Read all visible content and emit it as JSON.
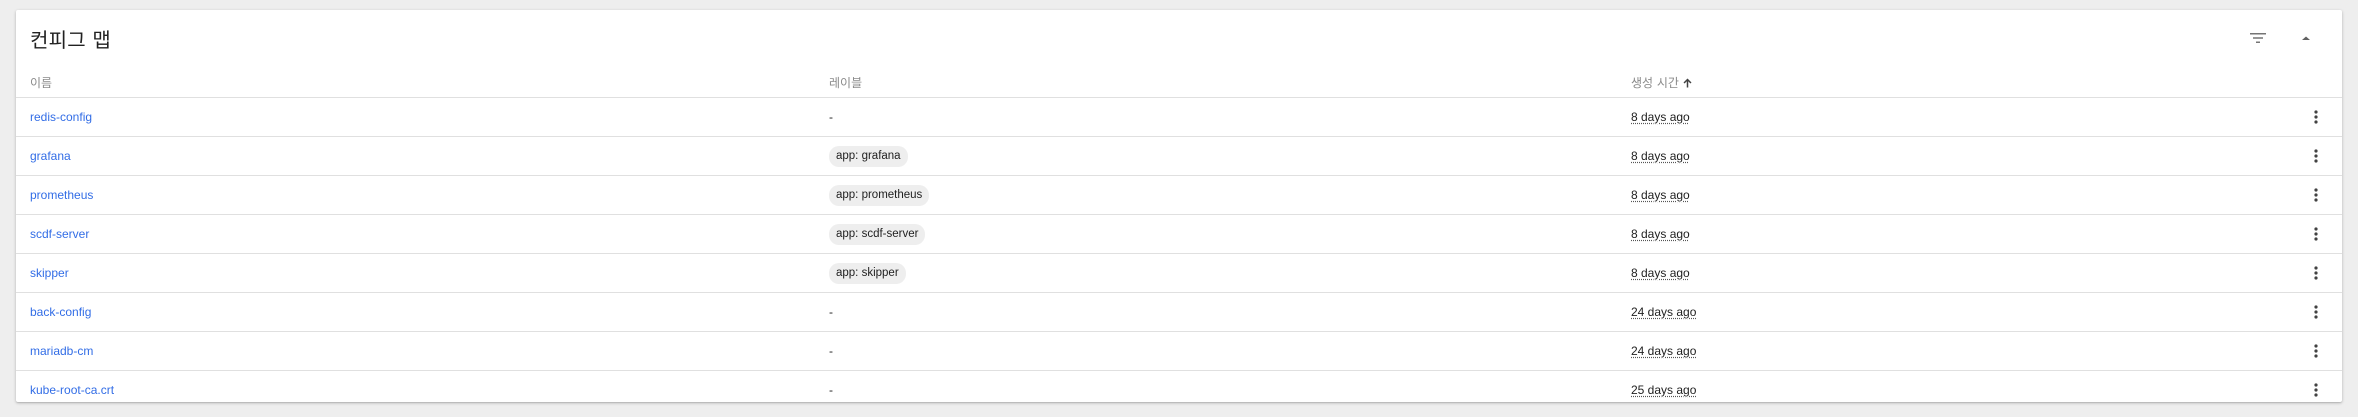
{
  "card": {
    "title": "컨피그 맵"
  },
  "header_actions": {
    "filter_icon": "filter-list-icon",
    "collapse_icon": "expand-less-icon"
  },
  "table": {
    "columns": {
      "name": "이름",
      "labels": "레이블",
      "created": "생성 시간"
    },
    "sort": {
      "column": "created",
      "direction": "ascending"
    },
    "rows": [
      {
        "name": "redis-config",
        "label": "-",
        "age": "8 days ago"
      },
      {
        "name": "grafana",
        "label": "app: grafana",
        "age": "8 days ago"
      },
      {
        "name": "prometheus",
        "label": "app: prometheus",
        "age": "8 days ago"
      },
      {
        "name": "scdf-server",
        "label": "app: scdf-server",
        "age": "8 days ago"
      },
      {
        "name": "skipper",
        "label": "app: skipper",
        "age": "8 days ago"
      },
      {
        "name": "back-config",
        "label": "-",
        "age": "24 days ago"
      },
      {
        "name": "mariadb-cm",
        "label": "-",
        "age": "24 days ago"
      },
      {
        "name": "kube-root-ca.crt",
        "label": "-",
        "age": "25 days ago"
      }
    ],
    "row_action_icon": "more-vert-icon"
  },
  "colors": {
    "link": "#326de6",
    "chip_bg": "#eeeeee",
    "page_bg": "#eeeeee"
  }
}
